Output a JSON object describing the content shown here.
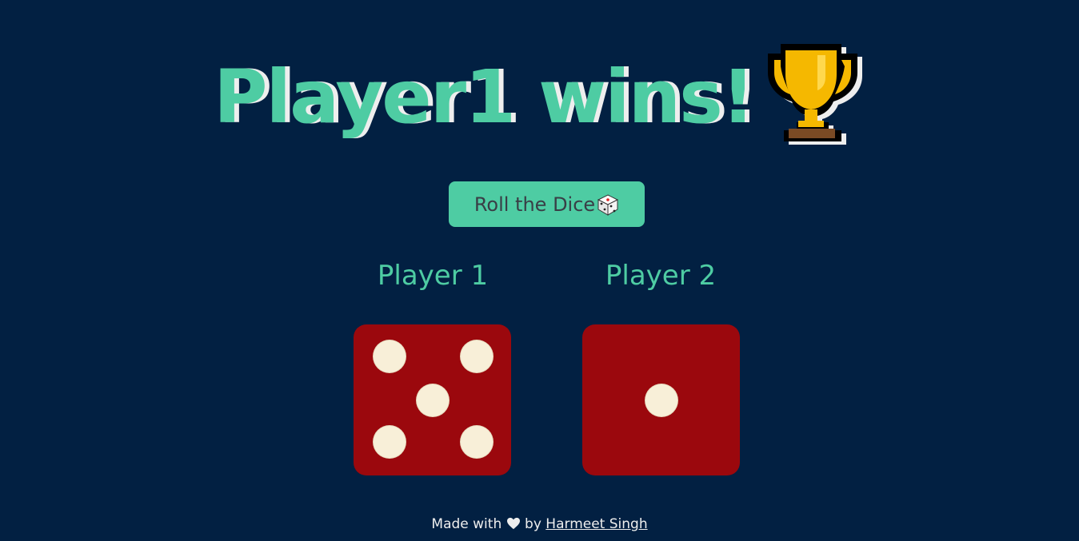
{
  "title": "Player1 wins!",
  "trophy_icon": "trophy-icon",
  "roll_button": {
    "label": "Roll the Dice",
    "icon": "dice-icon"
  },
  "players": [
    {
      "name": "Player 1",
      "die_value": 5
    },
    {
      "name": "Player 2",
      "die_value": 1
    }
  ],
  "footer": {
    "prefix": "Made with",
    "heart_icon": "heart-icon",
    "by": "by",
    "author": "Harmeet Singh"
  },
  "colors": {
    "background": "#022042",
    "accent": "#4ecca3",
    "die": "#9b080d",
    "pip": "#f8efd8",
    "button_text": "#393e46"
  }
}
